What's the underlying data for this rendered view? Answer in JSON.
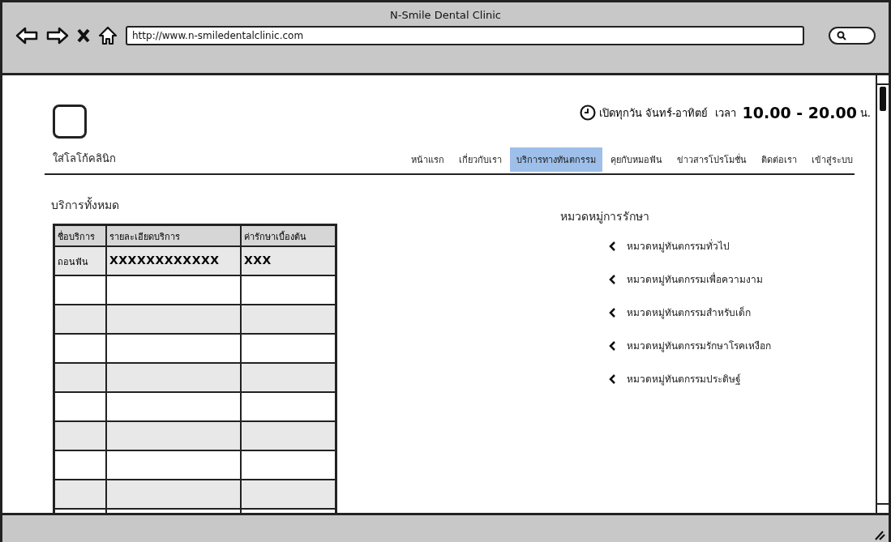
{
  "window": {
    "title": "N-Smile Dental Clinic",
    "url": "http://www.n-smiledentalclinic.com"
  },
  "header": {
    "hours_label": "เปิดทุกวัน จันทร์-อาทิตย์  เวลา",
    "hours": "10.00 - 20.00",
    "hours_unit": "น.",
    "logo_caption": "ใส่โลโก้คลินิก"
  },
  "nav": [
    {
      "label": "หน้าแรก",
      "selected": false
    },
    {
      "label": "เกี่ยวกับเรา",
      "selected": false
    },
    {
      "label": "บริการทางทันตกรรม",
      "selected": true
    },
    {
      "label": "คุยกับหมอฟัน",
      "selected": false
    },
    {
      "label": "ข่าวสารโปรโมชั่น",
      "selected": false
    },
    {
      "label": "ติดต่อเรา",
      "selected": false
    },
    {
      "label": "เข้าสู่ระบบ",
      "selected": false
    }
  ],
  "services": {
    "title": "บริการทั้งหมด",
    "columns": [
      "ชื่อบริการ",
      "รายละเอียดบริการ",
      "ค่ารักษาเบื้องต้น"
    ],
    "rows": [
      [
        "ถอนฟัน",
        "XXXXXXXXXXXX",
        "XXX"
      ]
    ]
  },
  "categories": {
    "title": "หมวดหมู่การรักษา",
    "items": [
      "หมวดหมู่ทันตกรรมทั่วไป",
      "หมวดหมู่ทันตกรรมเพื่อความงาม",
      "หมวดหมู่ทันตกรรมสำหรับเด็ก",
      "หมวดหมู่ทันตกรรมรักษาโรคเหงือก",
      "หมวดหมู่ทันตกรรมประดิษฐ์"
    ]
  }
}
